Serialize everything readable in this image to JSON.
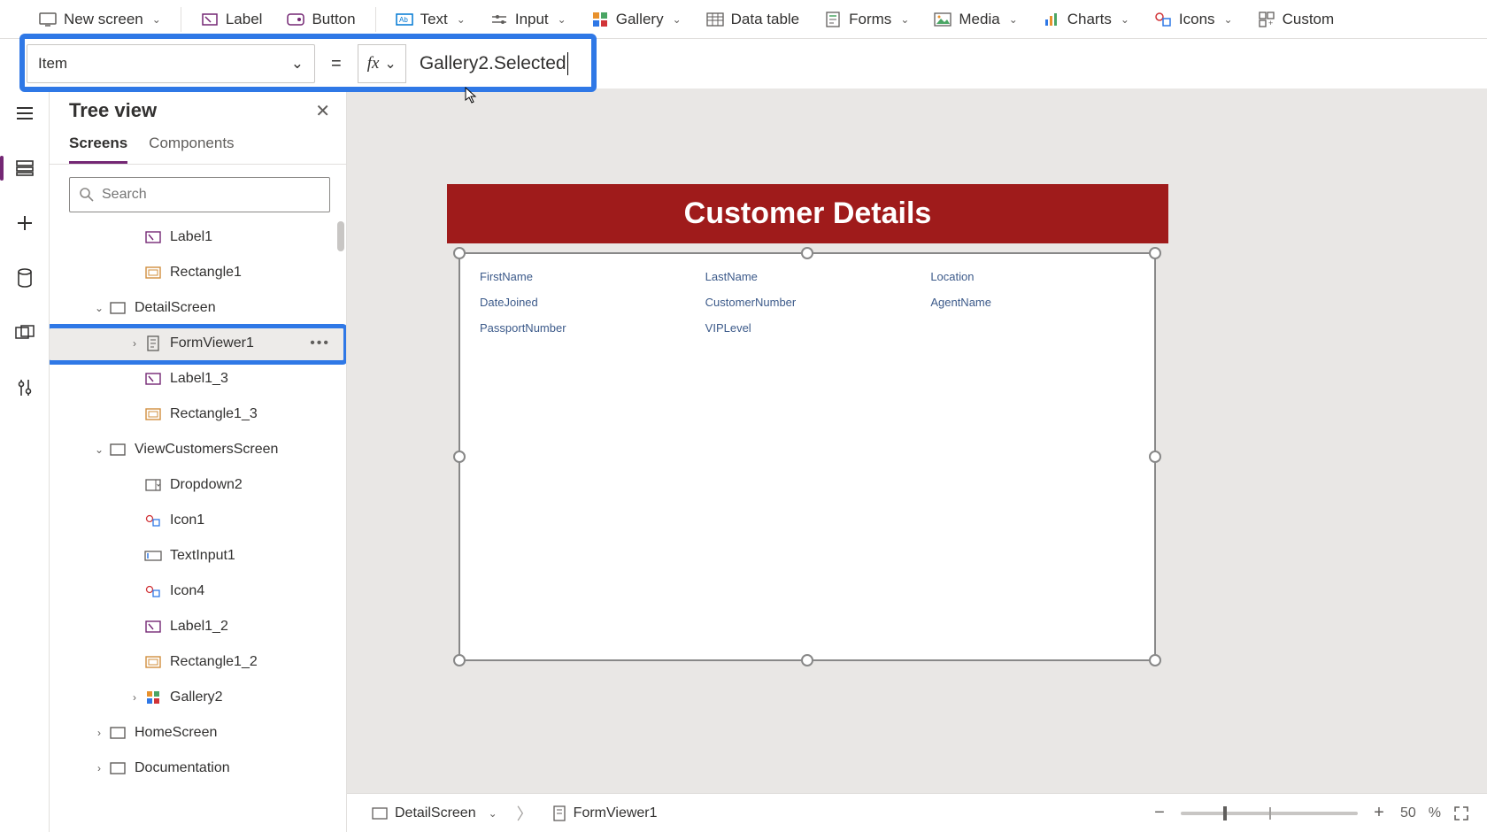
{
  "toolbar": {
    "new_screen": "New screen",
    "label": "Label",
    "button": "Button",
    "text": "Text",
    "input": "Input",
    "gallery": "Gallery",
    "data_table": "Data table",
    "forms": "Forms",
    "media": "Media",
    "charts": "Charts",
    "icons": "Icons",
    "custom": "Custom"
  },
  "formula": {
    "property": "Item",
    "fx": "fx",
    "expression": "Gallery2.Selected",
    "equals": "="
  },
  "tree": {
    "title": "Tree view",
    "tabs": {
      "screens": "Screens",
      "components": "Components"
    },
    "search_placeholder": "Search",
    "items": [
      {
        "label": "Label1",
        "icon": "label",
        "indent": "2",
        "expander": ""
      },
      {
        "label": "Rectangle1",
        "icon": "rect",
        "indent": "2",
        "expander": ""
      },
      {
        "label": "DetailScreen",
        "icon": "screen",
        "indent": "0e",
        "expander": "v"
      },
      {
        "label": "FormViewer1",
        "icon": "form",
        "indent": "1e",
        "expander": ">",
        "selected": true,
        "more": true
      },
      {
        "label": "Label1_3",
        "icon": "label",
        "indent": "2",
        "expander": ""
      },
      {
        "label": "Rectangle1_3",
        "icon": "rect",
        "indent": "2",
        "expander": ""
      },
      {
        "label": "ViewCustomersScreen",
        "icon": "screen",
        "indent": "0e",
        "expander": "v"
      },
      {
        "label": "Dropdown2",
        "icon": "dropdown",
        "indent": "2",
        "expander": ""
      },
      {
        "label": "Icon1",
        "icon": "iconctl",
        "indent": "2",
        "expander": ""
      },
      {
        "label": "TextInput1",
        "icon": "textinput",
        "indent": "2",
        "expander": ""
      },
      {
        "label": "Icon4",
        "icon": "iconctl",
        "indent": "2",
        "expander": ""
      },
      {
        "label": "Label1_2",
        "icon": "label",
        "indent": "2",
        "expander": ""
      },
      {
        "label": "Rectangle1_2",
        "icon": "rect",
        "indent": "2",
        "expander": ""
      },
      {
        "label": "Gallery2",
        "icon": "gallery",
        "indent": "1e",
        "expander": ">"
      },
      {
        "label": "HomeScreen",
        "icon": "screen",
        "indent": "0e",
        "expander": ">"
      },
      {
        "label": "Documentation",
        "icon": "screen",
        "indent": "0e",
        "expander": ">"
      }
    ]
  },
  "canvas": {
    "header": "Customer Details",
    "fields": [
      "FirstName",
      "LastName",
      "Location",
      "DateJoined",
      "CustomerNumber",
      "AgentName",
      "PassportNumber",
      "VIPLevel"
    ]
  },
  "breadcrumbs": {
    "screen": "DetailScreen",
    "control": "FormViewer1"
  },
  "zoom": {
    "value": "50",
    "unit": "%"
  }
}
